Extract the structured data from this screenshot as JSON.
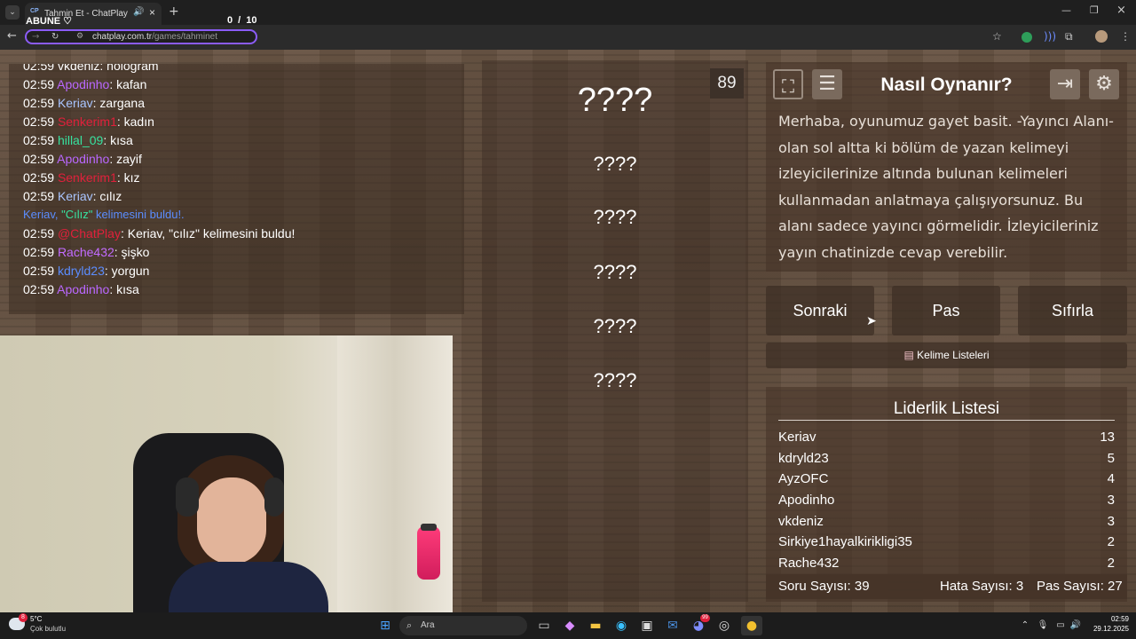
{
  "browser": {
    "tab_title": "Tahmin Et - ChatPlay",
    "tab_favicon": "CP",
    "url_domain": "chatplay.com.tr",
    "url_path": "/games/tahminet"
  },
  "overlay": {
    "abune": "ABUNE ♡",
    "counter": "0 / 10"
  },
  "chat": {
    "messages": [
      {
        "time": "02:59",
        "user": "vkdeniz",
        "text": ": hologram",
        "color": "#ffffff"
      },
      {
        "time": "02:59",
        "user": "Apodinho",
        "text": ": kafan",
        "color": "#b967ff"
      },
      {
        "time": "02:59",
        "user": "Keriav",
        "text": ": zargana",
        "color": "#a9c5ff"
      },
      {
        "time": "02:59",
        "user": "Senkerim1",
        "text": ": kadın",
        "color": "#e0203b"
      },
      {
        "time": "02:59",
        "user": "hillal_09",
        "text": ": kısa",
        "color": "#37e3a0"
      },
      {
        "time": "02:59",
        "user": "Apodinho",
        "text": ": zayif",
        "color": "#b967ff"
      },
      {
        "time": "02:59",
        "user": "Senkerim1",
        "text": ": kız",
        "color": "#e0203b"
      },
      {
        "time": "02:59",
        "user": "Keriav",
        "text": ": cılız",
        "color": "#a9c5ff"
      },
      {
        "time": "02:59",
        "user": "@ChatPlay",
        "text": ": Keriav, \"cılız\" kelimesini buldu!",
        "color": "#e0203b"
      },
      {
        "time": "02:59",
        "user": "Rache432",
        "text": ": şişko",
        "color": "#c26bff"
      },
      {
        "time": "02:59",
        "user": "kdryld23",
        "text": ": yorgun",
        "color": "#5b8dff"
      },
      {
        "time": "02:59",
        "user": "Apodinho",
        "text": ": kısa",
        "color": "#b967ff"
      }
    ],
    "system_prefix": "Keriav, ",
    "system_word": "\"Cılız\"",
    "system_suffix": " kelimesini buldu!."
  },
  "game": {
    "timer": "89",
    "words": [
      "????",
      "????",
      "????",
      "????",
      "????",
      "????"
    ]
  },
  "how_to": {
    "title": "Nasıl Oynanır?",
    "text": "Merhaba, oyunumuz gayet basit. -Yayıncı Alanı- olan sol altta ki bölüm de yazan kelimeyi izleyicilerinize altında bulunan kelimeleri kullanmadan anlatmaya çalışıyorsunuz. Bu alanı sadece yayıncı görmelidir. İzleyicileriniz yayın chatinizde cevap verebilir."
  },
  "buttons": {
    "next": "Sonraki",
    "pass": "Pas",
    "reset": "Sıfırla",
    "word_lists": "Kelime Listeleri"
  },
  "leaderboard": {
    "title": "Liderlik Listesi",
    "rows": [
      {
        "name": "Keriav",
        "score": "13"
      },
      {
        "name": "kdryld23",
        "score": "5"
      },
      {
        "name": "AyzOFC",
        "score": "4"
      },
      {
        "name": "Apodinho",
        "score": "3"
      },
      {
        "name": "vkdeniz",
        "score": "3"
      },
      {
        "name": "Sirkiye1hayalkirikligi35",
        "score": "2"
      },
      {
        "name": "Rache432",
        "score": "2"
      }
    ],
    "stats": {
      "questions": "Soru Sayısı: 39",
      "errors": "Hata Sayısı: 3",
      "passes": "Pas Sayısı: 27"
    }
  },
  "taskbar": {
    "temp": "5°C",
    "weather": "Çok bulutlu",
    "search": "Ara",
    "time": "02:59",
    "date": "29.12.2025",
    "weather_badge": "8",
    "discord_badge": "99"
  }
}
